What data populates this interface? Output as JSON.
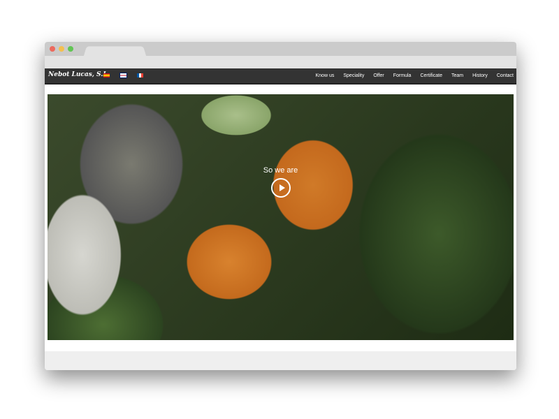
{
  "brand": {
    "logo": "Nebot Lucas, S.L"
  },
  "languages": [
    {
      "name": "Spanish",
      "icon": "flag-es-icon"
    },
    {
      "name": "English",
      "icon": "flag-uk-icon"
    },
    {
      "name": "French",
      "icon": "flag-fr-icon"
    }
  ],
  "menu": [
    "Know us",
    "Speciality",
    "Offer",
    "Formula",
    "Certificate",
    "Team",
    "History",
    "Contact"
  ],
  "hero": {
    "title": "So we are"
  }
}
